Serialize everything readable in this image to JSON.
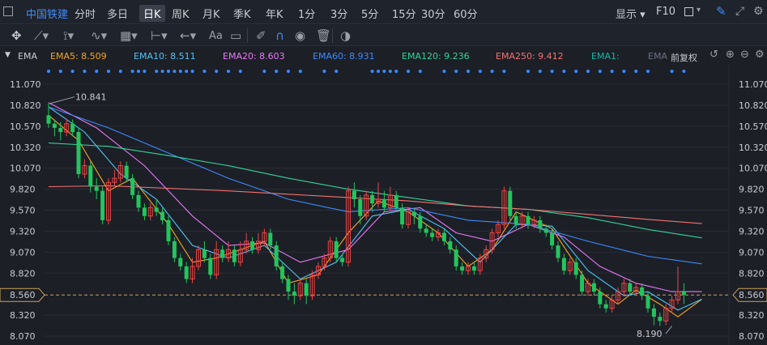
{
  "topbar": {
    "stock_name": "中国铁建",
    "periods": [
      "分时",
      "多日",
      "日K",
      "周K",
      "月K",
      "季K",
      "年K",
      "1分",
      "3分",
      "5分",
      "15分",
      "30分",
      "60分"
    ],
    "active_period": "日K",
    "display_label": "显示",
    "f10_label": "F10"
  },
  "toolbar": {
    "text_tool_label": "Aa"
  },
  "indicator": {
    "name": "EMA",
    "items": [
      {
        "label": "EMA5: 8.509",
        "color": "#f5a623"
      },
      {
        "label": "EMA10: 8.511",
        "color": "#4fc3f7"
      },
      {
        "label": "EMA20: 8.603",
        "color": "#e879f9"
      },
      {
        "label": "EMA60: 8.931",
        "color": "#3d8bfd"
      },
      {
        "label": "EMA120: 9.236",
        "color": "#34d399"
      },
      {
        "label": "EMA250: 9.412",
        "color": "#f87171"
      },
      {
        "label": "EMA1:",
        "color": "#14b8a6"
      },
      {
        "label": "EMA",
        "color": "#6b7280"
      }
    ],
    "adjust_label": "前复权"
  },
  "chart_data": {
    "type": "candlestick",
    "ylim": [
      8.07,
      11.07
    ],
    "y_ticks": [
      "11.070",
      "10.820",
      "10.570",
      "10.320",
      "10.070",
      "9.820",
      "9.570",
      "9.320",
      "9.070",
      "8.820",
      "8.560",
      "8.320",
      "8.070"
    ],
    "current_price": "8.560",
    "max_label": "10.841",
    "min_label": "8.190",
    "up_color": "#ef4444",
    "down_color": "#22c55e",
    "candles": [
      [
        10.7,
        10.6,
        10.841,
        10.55
      ],
      [
        10.6,
        10.55,
        10.65,
        10.45
      ],
      [
        10.55,
        10.5,
        10.62,
        10.4
      ],
      [
        10.5,
        10.6,
        10.66,
        10.45
      ],
      [
        10.6,
        10.5,
        10.65,
        10.45
      ],
      [
        10.5,
        10.0,
        10.55,
        9.95
      ],
      [
        10.0,
        10.1,
        10.18,
        9.95
      ],
      [
        10.1,
        9.85,
        10.15,
        9.78
      ],
      [
        9.85,
        9.8,
        9.95,
        9.7
      ],
      [
        9.8,
        9.45,
        9.85,
        9.4
      ],
      [
        9.45,
        9.9,
        9.95,
        9.4
      ],
      [
        9.9,
        9.95,
        10.05,
        9.85
      ],
      [
        9.95,
        10.1,
        10.15,
        9.9
      ],
      [
        10.1,
        9.95,
        10.15,
        9.9
      ],
      [
        9.95,
        9.75,
        10.0,
        9.7
      ],
      [
        9.75,
        9.6,
        9.8,
        9.55
      ],
      [
        9.6,
        9.5,
        9.65,
        9.45
      ],
      [
        9.5,
        9.6,
        9.65,
        9.45
      ],
      [
        9.6,
        9.55,
        9.7,
        9.5
      ],
      [
        9.55,
        9.45,
        9.6,
        9.4
      ],
      [
        9.45,
        9.2,
        9.5,
        9.15
      ],
      [
        9.2,
        9.0,
        9.25,
        8.95
      ],
      [
        9.0,
        8.9,
        9.05,
        8.85
      ],
      [
        8.9,
        8.75,
        8.95,
        8.7
      ],
      [
        8.75,
        8.9,
        9.0,
        8.7
      ],
      [
        8.9,
        9.1,
        9.15,
        8.85
      ],
      [
        9.1,
        9.0,
        9.2,
        8.95
      ],
      [
        9.0,
        8.8,
        9.05,
        8.75
      ],
      [
        8.8,
        9.1,
        9.2,
        8.75
      ],
      [
        9.1,
        9.0,
        9.15,
        8.95
      ],
      [
        9.0,
        9.1,
        9.2,
        8.95
      ],
      [
        9.1,
        8.95,
        9.15,
        8.9
      ],
      [
        8.95,
        9.1,
        9.2,
        8.9
      ],
      [
        9.1,
        9.2,
        9.3,
        9.05
      ],
      [
        9.2,
        9.1,
        9.25,
        9.05
      ],
      [
        9.1,
        9.2,
        9.3,
        9.05
      ],
      [
        9.2,
        9.3,
        9.35,
        9.15
      ],
      [
        9.3,
        9.15,
        9.35,
        9.1
      ],
      [
        9.15,
        8.9,
        9.2,
        8.85
      ],
      [
        8.9,
        8.75,
        8.95,
        8.7
      ],
      [
        8.75,
        8.6,
        8.8,
        8.5
      ],
      [
        8.6,
        8.55,
        8.7,
        8.45
      ],
      [
        8.55,
        8.7,
        8.75,
        8.5
      ],
      [
        8.7,
        8.55,
        8.75,
        8.45
      ],
      [
        8.55,
        8.8,
        8.85,
        8.5
      ],
      [
        8.8,
        8.9,
        8.95,
        8.75
      ],
      [
        8.9,
        9.0,
        9.05,
        8.85
      ],
      [
        9.0,
        9.2,
        9.25,
        8.95
      ],
      [
        9.2,
        9.0,
        9.25,
        8.95
      ],
      [
        9.0,
        8.95,
        9.05,
        8.9
      ],
      [
        8.95,
        9.8,
        9.85,
        8.9
      ],
      [
        9.8,
        9.7,
        9.9,
        9.6
      ],
      [
        9.7,
        9.5,
        9.75,
        9.4
      ],
      [
        9.5,
        9.75,
        9.8,
        9.45
      ],
      [
        9.75,
        9.65,
        9.8,
        9.55
      ],
      [
        9.65,
        9.7,
        9.9,
        9.6
      ],
      [
        9.7,
        9.6,
        9.8,
        9.55
      ],
      [
        9.6,
        9.75,
        9.85,
        9.55
      ],
      [
        9.75,
        9.6,
        9.8,
        9.55
      ],
      [
        9.6,
        9.4,
        9.65,
        9.35
      ],
      [
        9.4,
        9.55,
        9.6,
        9.35
      ],
      [
        9.55,
        9.5,
        9.6,
        9.4
      ],
      [
        9.5,
        9.35,
        9.55,
        9.3
      ],
      [
        9.35,
        9.3,
        9.4,
        9.25
      ],
      [
        9.3,
        9.25,
        9.35,
        9.2
      ],
      [
        9.25,
        9.3,
        9.35,
        9.2
      ],
      [
        9.3,
        9.2,
        9.35,
        9.15
      ],
      [
        9.2,
        9.1,
        9.25,
        9.05
      ],
      [
        9.1,
        8.9,
        9.15,
        8.85
      ],
      [
        8.9,
        8.85,
        8.95,
        8.8
      ],
      [
        8.85,
        8.9,
        8.95,
        8.8
      ],
      [
        8.9,
        8.85,
        8.95,
        8.8
      ],
      [
        8.85,
        9.0,
        9.05,
        8.8
      ],
      [
        9.0,
        9.1,
        9.15,
        8.95
      ],
      [
        9.1,
        9.3,
        9.35,
        9.05
      ],
      [
        9.3,
        9.4,
        9.45,
        9.25
      ],
      [
        9.4,
        9.8,
        9.85,
        9.35
      ],
      [
        9.8,
        9.5,
        9.85,
        9.45
      ],
      [
        9.5,
        9.4,
        9.55,
        9.35
      ],
      [
        9.4,
        9.5,
        9.55,
        9.35
      ],
      [
        9.5,
        9.4,
        9.55,
        9.35
      ],
      [
        9.4,
        9.45,
        9.5,
        9.35
      ],
      [
        9.45,
        9.35,
        9.5,
        9.3
      ],
      [
        9.35,
        9.3,
        9.4,
        9.25
      ],
      [
        9.3,
        9.15,
        9.35,
        9.1
      ],
      [
        9.15,
        9.0,
        9.2,
        8.95
      ],
      [
        9.0,
        8.85,
        9.05,
        8.8
      ],
      [
        8.85,
        8.95,
        9.0,
        8.8
      ],
      [
        8.95,
        8.8,
        9.0,
        8.75
      ],
      [
        8.8,
        8.6,
        8.85,
        8.55
      ],
      [
        8.6,
        8.7,
        8.75,
        8.55
      ],
      [
        8.7,
        8.6,
        8.75,
        8.55
      ],
      [
        8.6,
        8.45,
        8.65,
        8.4
      ],
      [
        8.45,
        8.4,
        8.5,
        8.35
      ],
      [
        8.4,
        8.5,
        8.55,
        8.35
      ],
      [
        8.5,
        8.6,
        8.65,
        8.45
      ],
      [
        8.6,
        8.7,
        8.75,
        8.55
      ],
      [
        8.7,
        8.6,
        8.75,
        8.55
      ],
      [
        8.6,
        8.65,
        8.7,
        8.55
      ],
      [
        8.65,
        8.55,
        8.7,
        8.5
      ],
      [
        8.55,
        8.4,
        8.6,
        8.35
      ],
      [
        8.4,
        8.3,
        8.45,
        8.2
      ],
      [
        8.3,
        8.25,
        8.35,
        8.19
      ],
      [
        8.25,
        8.4,
        8.45,
        8.2
      ],
      [
        8.4,
        8.5,
        8.55,
        8.35
      ],
      [
        8.5,
        8.6,
        8.9,
        8.45
      ],
      [
        8.6,
        8.56,
        8.7,
        8.45
      ]
    ],
    "ema": [
      {
        "name": "EMA5",
        "color": "#f5a623",
        "values": [
          [
            0,
            10.7
          ],
          [
            5,
            10.4
          ],
          [
            10,
            9.8
          ],
          [
            14,
            9.95
          ],
          [
            20,
            9.4
          ],
          [
            24,
            8.95
          ],
          [
            28,
            9.0
          ],
          [
            36,
            9.2
          ],
          [
            40,
            8.7
          ],
          [
            45,
            8.8
          ],
          [
            50,
            9.3
          ],
          [
            55,
            9.68
          ],
          [
            60,
            9.55
          ],
          [
            65,
            9.3
          ],
          [
            70,
            8.9
          ],
          [
            74,
            9.1
          ],
          [
            78,
            9.55
          ],
          [
            84,
            9.35
          ],
          [
            90,
            8.7
          ],
          [
            95,
            8.45
          ],
          [
            98,
            8.62
          ],
          [
            102,
            8.45
          ],
          [
            105,
            8.3
          ],
          [
            109,
            8.51
          ]
        ]
      },
      {
        "name": "EMA10",
        "color": "#4fc3f7",
        "values": [
          [
            0,
            10.8
          ],
          [
            6,
            10.5
          ],
          [
            12,
            10.0
          ],
          [
            18,
            9.7
          ],
          [
            24,
            9.15
          ],
          [
            30,
            9.0
          ],
          [
            36,
            9.15
          ],
          [
            42,
            8.75
          ],
          [
            48,
            8.95
          ],
          [
            54,
            9.5
          ],
          [
            60,
            9.58
          ],
          [
            66,
            9.35
          ],
          [
            72,
            8.95
          ],
          [
            78,
            9.4
          ],
          [
            84,
            9.38
          ],
          [
            90,
            8.85
          ],
          [
            96,
            8.55
          ],
          [
            100,
            8.6
          ],
          [
            105,
            8.38
          ],
          [
            109,
            8.51
          ]
        ]
      },
      {
        "name": "EMA20",
        "color": "#e879f9",
        "values": [
          [
            0,
            10.85
          ],
          [
            8,
            10.55
          ],
          [
            16,
            10.1
          ],
          [
            24,
            9.5
          ],
          [
            30,
            9.15
          ],
          [
            36,
            9.18
          ],
          [
            42,
            8.95
          ],
          [
            50,
            9.1
          ],
          [
            56,
            9.55
          ],
          [
            62,
            9.6
          ],
          [
            68,
            9.3
          ],
          [
            74,
            9.2
          ],
          [
            80,
            9.4
          ],
          [
            86,
            9.25
          ],
          [
            92,
            8.9
          ],
          [
            98,
            8.7
          ],
          [
            104,
            8.6
          ],
          [
            109,
            8.6
          ]
        ]
      },
      {
        "name": "EMA60",
        "color": "#3d8bfd",
        "values": [
          [
            0,
            10.8
          ],
          [
            10,
            10.55
          ],
          [
            20,
            10.25
          ],
          [
            30,
            9.95
          ],
          [
            40,
            9.7
          ],
          [
            50,
            9.55
          ],
          [
            60,
            9.6
          ],
          [
            70,
            9.45
          ],
          [
            80,
            9.4
          ],
          [
            90,
            9.2
          ],
          [
            100,
            9.02
          ],
          [
            109,
            8.93
          ]
        ]
      },
      {
        "name": "EMA120",
        "color": "#34d399",
        "values": [
          [
            0,
            10.37
          ],
          [
            10,
            10.33
          ],
          [
            20,
            10.22
          ],
          [
            30,
            10.1
          ],
          [
            40,
            9.95
          ],
          [
            50,
            9.82
          ],
          [
            60,
            9.72
          ],
          [
            70,
            9.62
          ],
          [
            80,
            9.58
          ],
          [
            90,
            9.48
          ],
          [
            100,
            9.34
          ],
          [
            109,
            9.24
          ]
        ]
      },
      {
        "name": "EMA250",
        "color": "#f87171",
        "values": [
          [
            0,
            9.85
          ],
          [
            10,
            9.86
          ],
          [
            20,
            9.83
          ],
          [
            30,
            9.8
          ],
          [
            40,
            9.76
          ],
          [
            50,
            9.72
          ],
          [
            60,
            9.68
          ],
          [
            70,
            9.62
          ],
          [
            80,
            9.58
          ],
          [
            90,
            9.52
          ],
          [
            100,
            9.46
          ],
          [
            109,
            9.41
          ]
        ]
      }
    ]
  }
}
